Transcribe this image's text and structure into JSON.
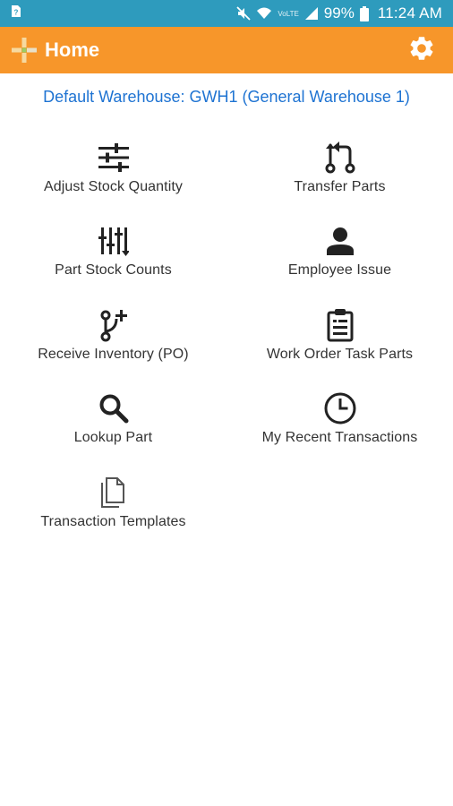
{
  "status_bar": {
    "battery": "99%",
    "time": "11:24 AM",
    "network_label": "VoLTE",
    "icons": [
      "sim-card-icon",
      "mute-icon",
      "wifi-icon",
      "signal-icon",
      "battery-icon"
    ]
  },
  "app_bar": {
    "title": "Home",
    "logo": "app-logo-icon",
    "settings_icon": "gear-icon"
  },
  "warehouse_link": "Default Warehouse: GWH1 (General Warehouse 1)",
  "menu": [
    {
      "label": "Adjust Stock Quantity",
      "icon": "sliders-icon"
    },
    {
      "label": "Transfer Parts",
      "icon": "transfer-icon"
    },
    {
      "label": "Part Stock Counts",
      "icon": "stock-counts-icon"
    },
    {
      "label": "Employee Issue",
      "icon": "person-icon"
    },
    {
      "label": "Receive Inventory (PO)",
      "icon": "receive-icon"
    },
    {
      "label": "Work Order Task Parts",
      "icon": "clipboard-icon"
    },
    {
      "label": "Lookup Part",
      "icon": "search-icon"
    },
    {
      "label": "My Recent Transactions",
      "icon": "clock-icon"
    },
    {
      "label": "Transaction Templates",
      "icon": "documents-icon"
    }
  ],
  "colors": {
    "status_bar": "#2e9bbd",
    "app_bar": "#f7962a",
    "link": "#1e73d2",
    "text": "#333333"
  }
}
